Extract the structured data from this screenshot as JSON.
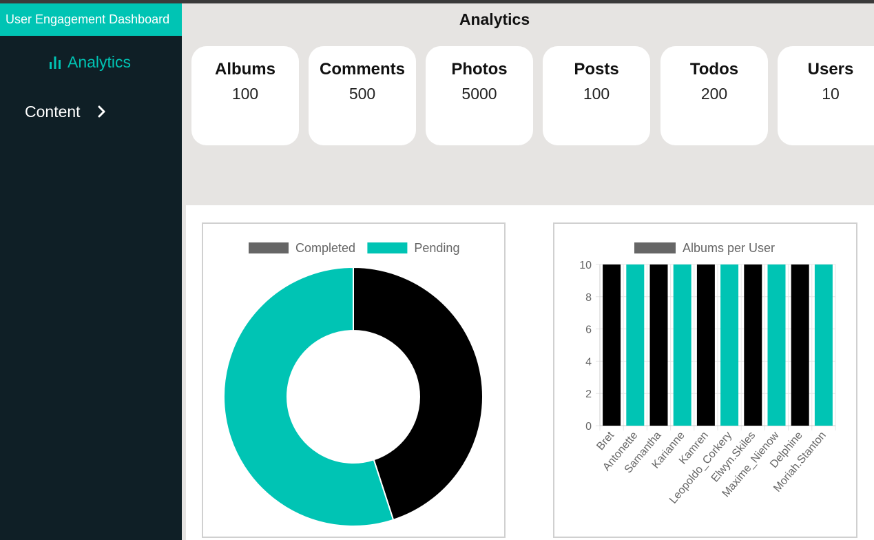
{
  "app": {
    "title": "User Engagement Dashboard"
  },
  "sidebar": {
    "items": [
      {
        "label": "Analytics",
        "icon": "bar-chart-icon",
        "active": true
      },
      {
        "label": "Content",
        "icon": "chevron-right-icon",
        "active": false
      }
    ]
  },
  "main": {
    "title": "Analytics",
    "stats": [
      {
        "label": "Albums",
        "value": "100"
      },
      {
        "label": "Comments",
        "value": "500"
      },
      {
        "label": "Photos",
        "value": "5000"
      },
      {
        "label": "Posts",
        "value": "100"
      },
      {
        "label": "Todos",
        "value": "200"
      },
      {
        "label": "Users",
        "value": "10"
      }
    ]
  },
  "colors": {
    "accent": "#00c4b4",
    "sidebar_bg": "#0f1f26",
    "completed": "#000000",
    "pending": "#00c4b4",
    "legend_completed_swatch": "#666666"
  },
  "chart_data": [
    {
      "type": "pie",
      "variant": "doughnut",
      "categories": [
        "Completed",
        "Pending"
      ],
      "values": [
        90,
        110
      ],
      "colors": [
        "#000000",
        "#00c4b4"
      ],
      "legend": "top"
    },
    {
      "type": "bar",
      "series": [
        {
          "name": "Albums per User",
          "values": [
            10,
            10,
            10,
            10,
            10,
            10,
            10,
            10,
            10,
            10
          ]
        }
      ],
      "categories": [
        "Bret",
        "Antonette",
        "Samantha",
        "Karianne",
        "Kamren",
        "Leopoldo_Corkery",
        "Elwyn.Skiles",
        "Maxime_Nienow",
        "Delphine",
        "Moriah.Stanton"
      ],
      "bar_colors": [
        "#000000",
        "#00c4b4",
        "#000000",
        "#00c4b4",
        "#000000",
        "#00c4b4",
        "#000000",
        "#00c4b4",
        "#000000",
        "#00c4b4"
      ],
      "ylim": [
        0,
        10
      ],
      "yticks": [
        0,
        2,
        4,
        6,
        8,
        10
      ],
      "grid": true,
      "legend": "top"
    }
  ]
}
